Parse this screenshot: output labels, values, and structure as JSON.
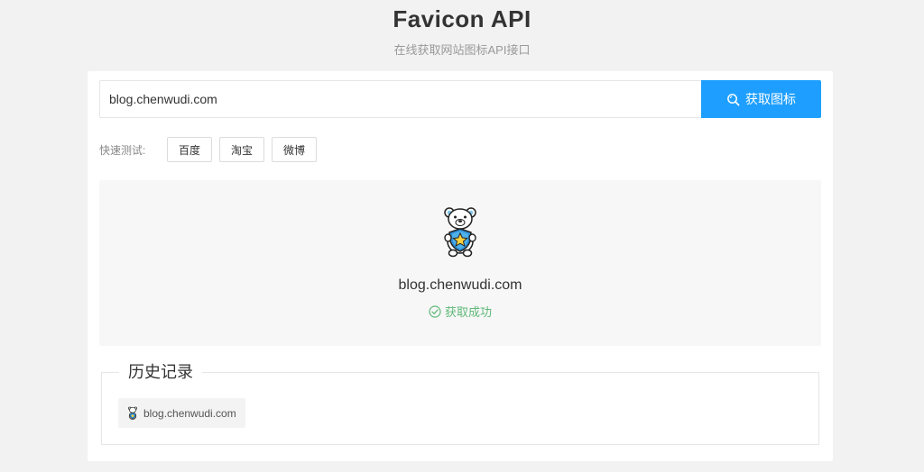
{
  "header": {
    "title": "Favicon API",
    "subtitle": "在线获取网站图标API接口"
  },
  "search": {
    "value": "blog.chenwudi.com",
    "button_label": "获取图标",
    "button_icon": "search-icon"
  },
  "quick_test": {
    "label": "快速测试:",
    "buttons": [
      "百度",
      "淘宝",
      "微博"
    ]
  },
  "result": {
    "icon": "polar-bear-shield-icon",
    "domain": "blog.chenwudi.com",
    "status": "获取成功",
    "status_icon": "check-circle-icon",
    "status_color": "#5fb878"
  },
  "history": {
    "legend": "历史记录",
    "items": [
      {
        "label": "blog.chenwudi.com",
        "icon": "polar-bear-shield-icon"
      }
    ]
  },
  "colors": {
    "accent": "#1e9fff",
    "success": "#5fb878",
    "background": "#f2f2f2"
  }
}
